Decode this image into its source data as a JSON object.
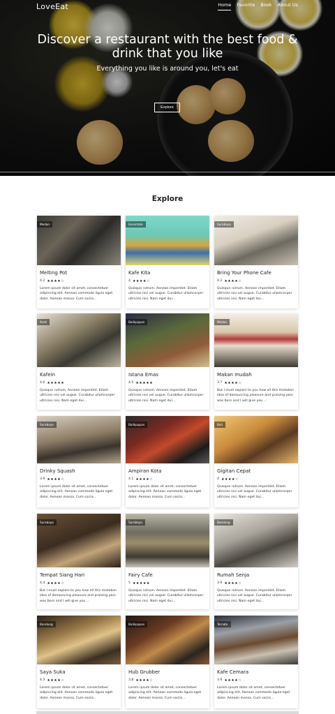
{
  "header": {
    "brand": "LoveEat",
    "nav": [
      "Home",
      "Favorite",
      "Book",
      "About Us"
    ]
  },
  "hero": {
    "title": "Discover a restaurant with the best food & drink that you like",
    "subtitle": "Everything you like is around you, let's eat",
    "button": "Explore"
  },
  "explore": {
    "title": "Explore",
    "star_color": "#111111",
    "restaurants": [
      {
        "name": "Melting Pot",
        "city": "Medan",
        "rating": "4.2",
        "stars": "★★★★☆",
        "description": "Lorem ipsum dolor sit amet, consectetuer adipiscing elit. Aenean commodo ligula eget dolor. Aenean massa. Cum sociis..."
      },
      {
        "name": "Kafe Kita",
        "city": "Gorontalo",
        "rating": "4",
        "stars": "★★★★☆",
        "description": "Quisque rutrum. Aenean imperdiet. Etiam ultricies nisi vel augue. Curabitur ullamcorper ultricies nisi. Nam eget dui..."
      },
      {
        "name": "Bring Your Phone Cafe",
        "city": "Surabaya",
        "rating": "4.2",
        "stars": "★★★★☆",
        "description": "Quisque rutrum. Aenean imperdiet. Etiam ultricies nisi vel augue. Curabitur ullamcorper ultricies nisi. Nam eget dui..."
      },
      {
        "name": "Kafein",
        "city": "Aceh",
        "rating": "4.6",
        "stars": "★★★★★",
        "description": "Quisque rutrum. Aenean imperdiet. Etiam ultricies nisi vel augue. Curabitur ullamcorper ultricies nisi. Nam eget dui..."
      },
      {
        "name": "Istana Emas",
        "city": "Balikpapan",
        "rating": "4.5",
        "stars": "★★★★★",
        "description": "Quisque rutrum. Aenean imperdiet. Etiam ultricies nisi vel augue. Curabitur ullamcorper ultricies nisi. Nam eget dui..."
      },
      {
        "name": "Makan mudah",
        "city": "Medan",
        "rating": "3.7",
        "stars": "★★★★☆",
        "description": "But I must explain to you how all this mistaken idea of denouncing pleasure and praising pain was born and I will give you ..."
      },
      {
        "name": "Drinky Squash",
        "city": "Surabaya",
        "rating": "3.9",
        "stars": "★★★★☆",
        "description": "Lorem ipsum dolor sit amet, consectetuer adipiscing elit. Aenean commodo ligula eget dolor. Aenean massa. Cum sociis..."
      },
      {
        "name": "Ampiran Kota",
        "city": "Balikpapan",
        "rating": "4.1",
        "stars": "★★★★☆",
        "description": "Lorem ipsum dolor sit amet, consectetuer adipiscing elit. Aenean commodo ligula eget dolor. Aenean massa. Cum sociis..."
      },
      {
        "name": "Gigitan Cepat",
        "city": "Bali",
        "rating": "4",
        "stars": "★★★★☆",
        "description": "Quisque rutrum. Aenean imperdiet. Etiam ultricies nisi vel augue. Curabitur ullamcorper ultricies nisi. Nam eget dui..."
      },
      {
        "name": "Tempat Siang Hari",
        "city": "Surabaya",
        "rating": "4.4",
        "stars": "★★★★☆",
        "description": "But I must explain to you how all this mistaken idea of denouncing pleasure and praising pain was born and I will give you ..."
      },
      {
        "name": "Fairy Cafe",
        "city": "Surabaya",
        "rating": "5",
        "stars": "★★★★★",
        "description": "Quisque rutrum. Aenean imperdiet. Etiam ultricies nisi vel augue. Curabitur ullamcorper ultricies nisi. Nam eget dui..."
      },
      {
        "name": "Rumah Senja",
        "city": "Bandung",
        "rating": "3.9",
        "stars": "★★★★☆",
        "description": "Quisque rutrum. Aenean imperdiet. Etiam ultricies nisi vel augue. Curabitur ullamcorper ultricies nisi. Nam eget dui..."
      },
      {
        "name": "Saya Suka",
        "city": "Bandung",
        "rating": "4.3",
        "stars": "★★★★☆",
        "description": "Lorem ipsum dolor sit amet, consectetuer adipiscing elit. Aenean commodo ligula eget dolor. Aenean massa. Cum sociis..."
      },
      {
        "name": "Hub Grubber",
        "city": "Balikpapan",
        "rating": "3.8",
        "stars": "★★★★☆",
        "description": "Lorem ipsum dolor sit amet, consectetuer adipiscing elit. Aenean commodo ligula eget dolor. Aenean massa. Cum sociis..."
      },
      {
        "name": "Kafe Cemara",
        "city": "Ternate",
        "rating": "3.6",
        "stars": "★★★★☆",
        "description": "Lorem ipsum dolor sit amet, consectetuer adipiscing elit. Aenean commodo ligula eget dolor. Aenean massa. Cum sociis..."
      }
    ]
  }
}
